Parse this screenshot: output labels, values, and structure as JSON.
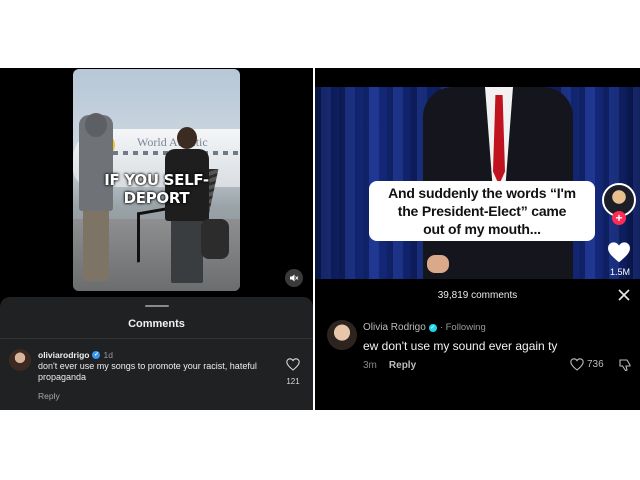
{
  "instagram": {
    "video_overlay_text": "IF YOU SELF-DEPORT",
    "plane_livery_text": "World Atlantic",
    "comments_title": "Comments",
    "comment": {
      "username": "oliviarodrigo",
      "time": "1d",
      "text": "don't ever use my songs to promote your racist, hateful propaganda",
      "reply_label": "Reply",
      "likes": "121"
    }
  },
  "tiktok": {
    "caption_lines": [
      "And suddenly the words “I'm",
      "the President-Elect” came",
      "out of my mouth..."
    ],
    "like_count": "1.5M",
    "comments_title": "39,819 comments",
    "comment": {
      "username": "Olivia Rodrigo",
      "following_label": "· Following",
      "text": "ew don't use my sound ever again ty",
      "time": "3m",
      "reply_label": "Reply",
      "likes": "736"
    }
  },
  "colors": {
    "tiktok_accent": "#fe2c55",
    "verified_blue": "#3897f0",
    "tie_red": "#c1121f"
  },
  "icons": [
    "mute-icon",
    "heart-outline-icon",
    "verified-badge-icon",
    "heart-filled-icon",
    "close-icon",
    "dislike-icon",
    "plus-icon"
  ]
}
